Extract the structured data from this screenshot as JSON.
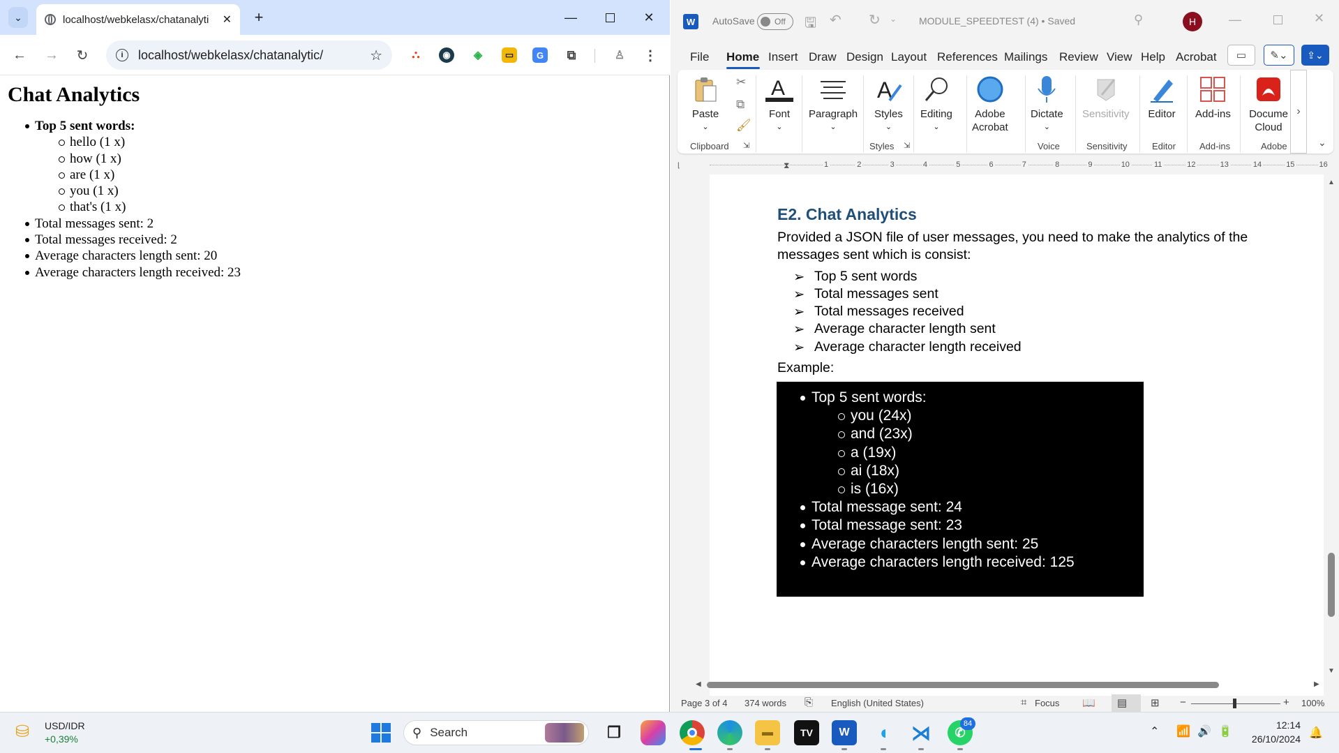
{
  "chrome": {
    "tab_title": "localhost/webkelasx/chatanalyti",
    "url": "localhost/webkelasx/chatanalytic/",
    "page": {
      "heading": "Chat Analytics",
      "top_words_label": "Top 5 sent words:",
      "top_words": [
        "hello (1 x)",
        "how (1 x)",
        "are (1 x)",
        "you (1 x)",
        "that's (1 x)"
      ],
      "stats": [
        "Total messages sent: 2",
        "Total messages received: 2",
        "Average characters length sent: 20",
        "Average characters length received: 23"
      ]
    }
  },
  "word": {
    "autosave_label": "AutoSave",
    "autosave_state": "Off",
    "doc_title": "MODULE_SPEEDTEST (4) • Saved",
    "user_initial": "H",
    "menu": [
      "File",
      "Home",
      "Insert",
      "Draw",
      "Design",
      "Layout",
      "References",
      "Mailings",
      "Review",
      "View",
      "Help",
      "Acrobat"
    ],
    "ribbon": {
      "paste": "Paste",
      "font": "Font",
      "paragraph": "Paragraph",
      "styles": "Styles",
      "editing": "Editing",
      "adobe_acrobat_1": "Adobe",
      "adobe_acrobat_2": "Acrobat",
      "dictate": "Dictate",
      "sensitivity": "Sensitivity",
      "editor": "Editor",
      "addins": "Add-ins",
      "document_cloud_1": "Docume",
      "document_cloud_2": "Cloud",
      "groups": {
        "clipboard": "Clipboard",
        "styles": "Styles",
        "voice": "Voice",
        "sensitivity": "Sensitivity",
        "editor": "Editor",
        "addins": "Add-ins",
        "adobe": "Adobe"
      }
    },
    "ruler_numbers": [
      "1",
      "2",
      "3",
      "4",
      "5",
      "6",
      "7",
      "8",
      "9",
      "10",
      "11",
      "12",
      "13",
      "14",
      "15",
      "16"
    ],
    "document": {
      "heading": "E2. Chat Analytics",
      "intro": "Provided a JSON file of user messages, you need to make the analytics of the messages sent which is consist:",
      "requirements": [
        "Top 5 sent words",
        "Total messages sent",
        "Total messages received",
        "Average character length sent",
        "Average character length received"
      ],
      "example_label": "Example:",
      "example": {
        "top_words_label": "Top 5 sent words:",
        "top_words": [
          "you (24x)",
          "and (23x)",
          "a (19x)",
          "ai (18x)",
          "is (16x)"
        ],
        "stats": [
          "Total message sent: 24",
          "Total message sent: 23",
          "Average characters length sent: 25",
          "Average characters length received: 125"
        ]
      }
    },
    "status": {
      "page": "Page 3 of 4",
      "words": "374 words",
      "language": "English (United States)",
      "focus": "Focus",
      "zoom": "100%"
    }
  },
  "taskbar": {
    "ticker_name": "USD/IDR",
    "ticker_change": "+0,39%",
    "search_placeholder": "Search",
    "whatsapp_badge": "84",
    "time": "12:14",
    "date": "26/10/2024"
  }
}
